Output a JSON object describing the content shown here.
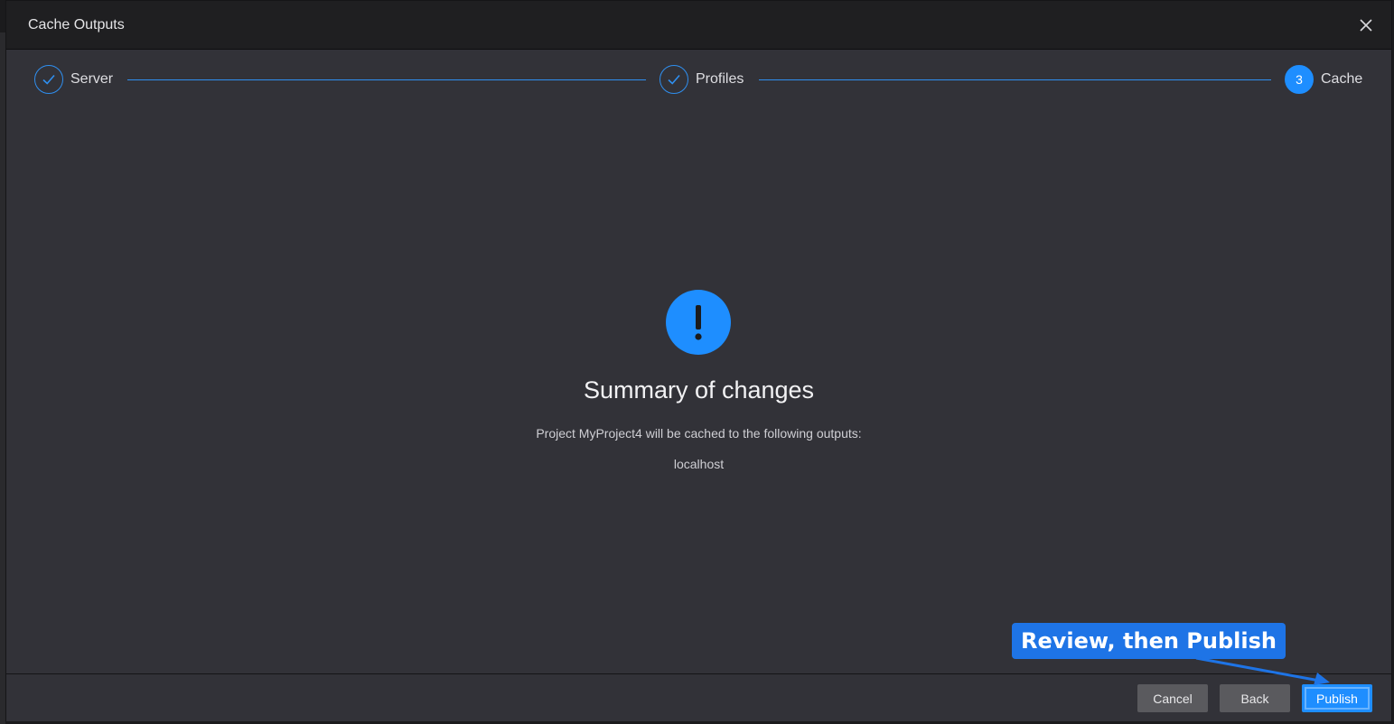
{
  "window": {
    "title": "Cache Outputs"
  },
  "stepper": {
    "steps": [
      {
        "label": "Server",
        "status": "completed"
      },
      {
        "label": "Profiles",
        "status": "completed"
      },
      {
        "label": "Cache",
        "number": "3",
        "status": "active"
      }
    ]
  },
  "summary": {
    "title": "Summary of changes",
    "description": "Project MyProject4 will be cached to the following outputs:",
    "outputs": [
      "localhost"
    ]
  },
  "footer": {
    "cancel_label": "Cancel",
    "back_label": "Back",
    "publish_label": "Publish"
  },
  "annotation": {
    "text": "Review, then Publish"
  },
  "colors": {
    "accent": "#1e8eff",
    "dialog_bg": "#323238",
    "titlebar_bg": "#1f1f21",
    "button_secondary": "#5a5a5e",
    "callout_bg": "#1e74e6"
  },
  "icons": {
    "close": "close-icon",
    "completed_step": "checkmark-icon",
    "alert": "exclamation-icon"
  }
}
